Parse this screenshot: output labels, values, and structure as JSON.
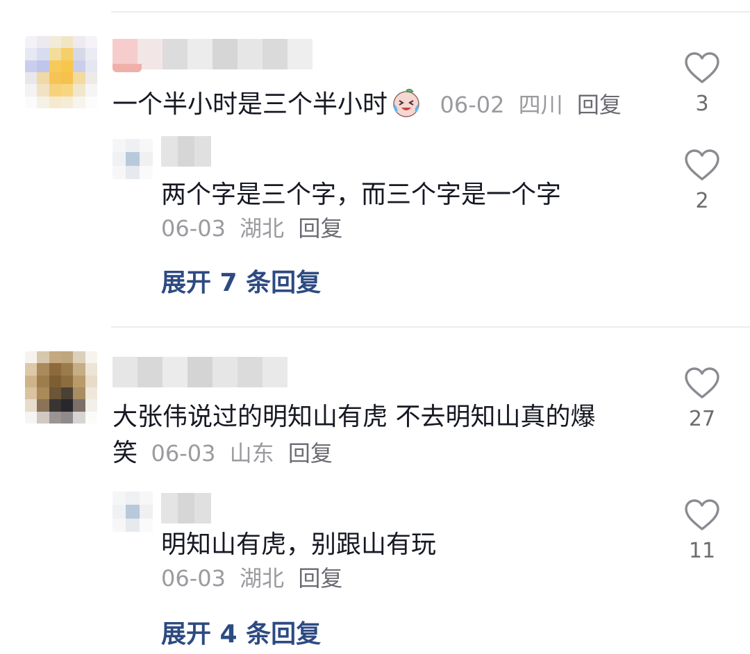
{
  "comments": [
    {
      "text": "一个半小时是三个半小时",
      "emoji": "laughing-crying-peach-emoji",
      "date": "06-02",
      "location": "四川",
      "reply_label": "回复",
      "likes": "3",
      "reply": {
        "text": "两个字是三个字，而三个字是一个字",
        "date": "06-03",
        "location": "湖北",
        "reply_label": "回复",
        "likes": "2"
      },
      "expand_label": "展开 7 条回复"
    },
    {
      "text_line1": "大张伟说过的明知山有虎 不去明知山真的爆",
      "text_line2": "笑",
      "date": "06-03",
      "location": "山东",
      "reply_label": "回复",
      "likes": "27",
      "reply": {
        "text": "明知山有虎，别跟山有玩",
        "date": "06-03",
        "location": "湖北",
        "reply_label": "回复",
        "likes": "11"
      },
      "expand_label": "展开 4 条回复"
    }
  ],
  "colors": {
    "expand_link": "#2d4a82",
    "meta_text": "#9a9a9f",
    "divider": "#ececec",
    "heart_outline": "#8a8a90"
  },
  "icons": {
    "like": "heart-outline-icon"
  }
}
